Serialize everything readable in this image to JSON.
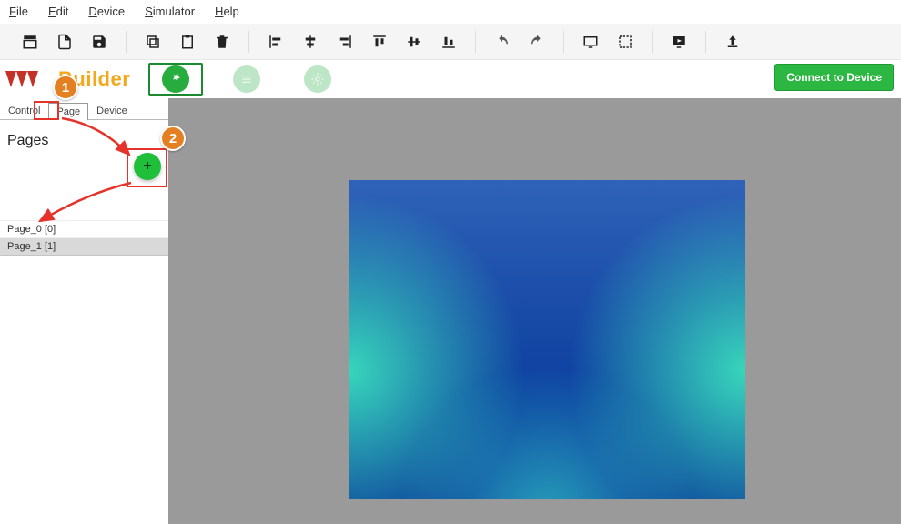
{
  "menubar": {
    "file": "File",
    "edit": "Edit",
    "device": "Device",
    "simulator": "Simulator",
    "help": "Help"
  },
  "brand": {
    "title": "Builder"
  },
  "connect_label": "Connect to Device",
  "side_tabs": {
    "control": "Control",
    "page": "Page",
    "device": "Device"
  },
  "sidebar": {
    "title": "Pages",
    "add_label": "+",
    "items": [
      {
        "label": "Page_0 [0]",
        "selected": false
      },
      {
        "label": "Page_1 [1]",
        "selected": true
      }
    ]
  },
  "annotations": {
    "step1": "1",
    "step2": "2"
  }
}
